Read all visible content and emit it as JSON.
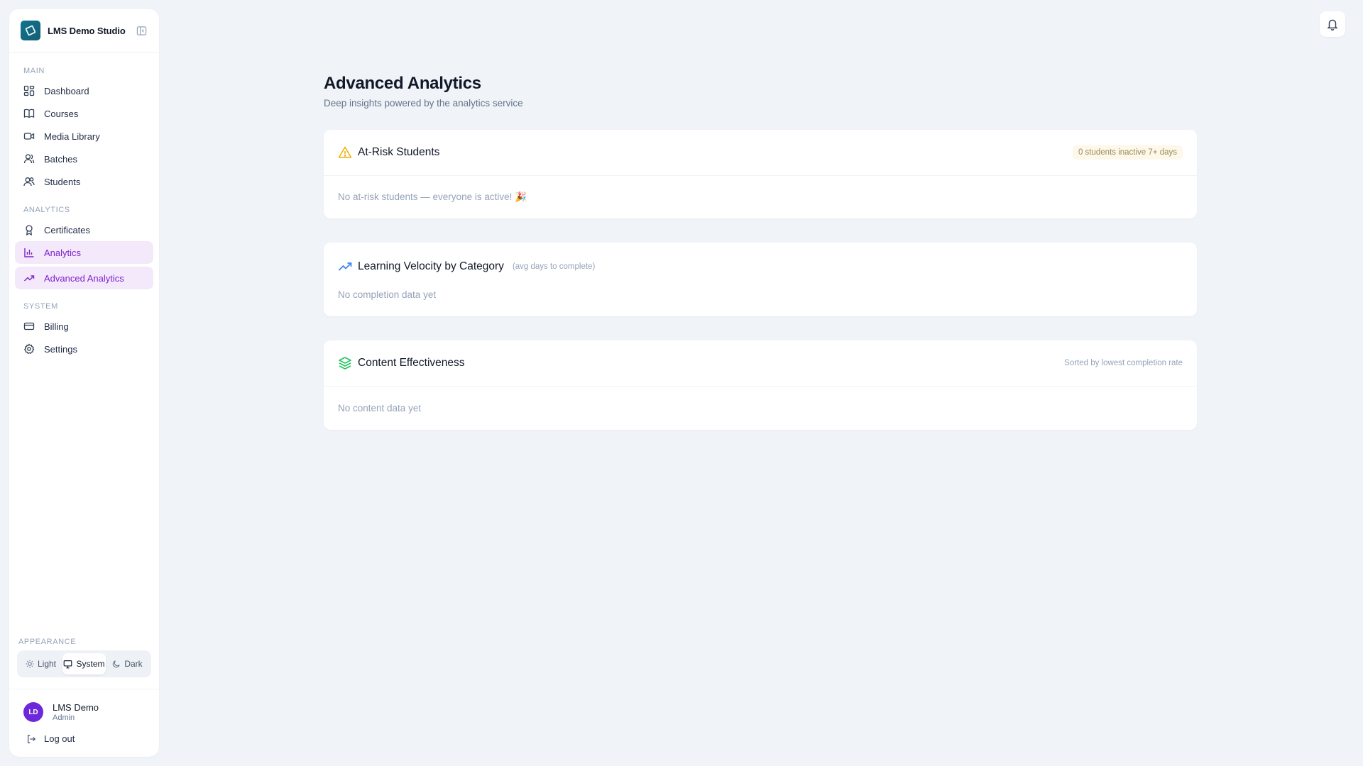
{
  "brand": {
    "name": "LMS Demo Studio"
  },
  "sidebar": {
    "sections": [
      {
        "label": "MAIN"
      },
      {
        "label": "ANALYTICS"
      },
      {
        "label": "SYSTEM"
      }
    ],
    "items": [
      {
        "label": "Dashboard",
        "icon": "grid-icon"
      },
      {
        "label": "Courses",
        "icon": "book-icon"
      },
      {
        "label": "Media Library",
        "icon": "video-icon"
      },
      {
        "label": "Batches",
        "icon": "user-group-icon"
      },
      {
        "label": "Students",
        "icon": "users-icon"
      },
      {
        "label": "Certificates",
        "icon": "award-icon"
      },
      {
        "label": "Analytics",
        "icon": "bar-chart-icon",
        "active": true
      },
      {
        "label": "Advanced Analytics",
        "icon": "trending-up-icon",
        "active": true
      },
      {
        "label": "Billing",
        "icon": "credit-card-icon"
      },
      {
        "label": "Settings",
        "icon": "gear-icon"
      }
    ],
    "active_color": "#7e22ce",
    "active_bg": "#f4e8fb"
  },
  "appearance": {
    "label": "APPEARANCE",
    "options": [
      "Light",
      "System",
      "Dark"
    ],
    "selected": "System"
  },
  "user": {
    "initials": "LD",
    "name": "LMS Demo",
    "role": "Admin"
  },
  "logout": {
    "label": "Log out"
  },
  "page": {
    "title": "Advanced Analytics",
    "subtitle": "Deep insights powered by the analytics service"
  },
  "cards": {
    "at_risk": {
      "title": "At-Risk Students",
      "badge": "0 students inactive 7+ days",
      "empty": "No at-risk students — everyone is active! 🎉",
      "icon_color": "#eab308"
    },
    "velocity": {
      "title": "Learning Velocity by Category",
      "hint": "(avg days to complete)",
      "empty": "No completion data yet",
      "icon_color": "#3b82f6"
    },
    "content": {
      "title": "Content Effectiveness",
      "note": "Sorted by lowest completion rate",
      "empty": "No content data yet",
      "icon_color": "#22c55e"
    }
  }
}
